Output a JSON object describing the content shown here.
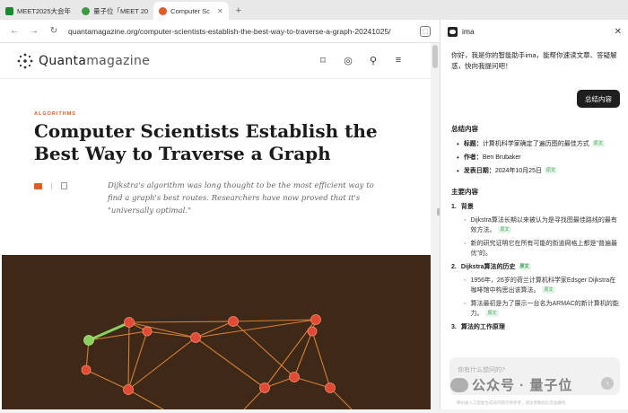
{
  "browser": {
    "tabs": [
      {
        "label": "MEET2025大会年",
        "active": false,
        "favicon_color": "#1a8a2e"
      },
      {
        "label": "量子位「MEET 20",
        "active": false,
        "favicon_color": "#3a9a40"
      },
      {
        "label": "Computer Sc",
        "active": true,
        "favicon_color": "#e35b24"
      }
    ],
    "new_tab": "+",
    "url": "quantamagazine.org/computer-scientists-establish-the-best-way-to-traverse-a-graph-20241025/"
  },
  "site": {
    "logo_bold": "Quanta",
    "logo_light": "magazine",
    "header_icons": [
      "bookmark-icon",
      "user-icon",
      "search-icon",
      "menu-icon"
    ]
  },
  "article": {
    "category": "ALGORITHMS",
    "title": "Computer Scientists Establish the Best Way to Traverse a Graph",
    "dek": "Dijkstra's algorithm was long thought to be the most efficient way to find a graph's best routes. Researchers have now proved that it's \"universally optimal.\""
  },
  "assistant": {
    "title": "ima",
    "greeting": "你好，我是你的智能助手ima，能帮你速读文章、答疑解惑，快向我提问吧！",
    "user_message": "总结内容",
    "summary_title": "总结内容",
    "source_tag": "原文",
    "meta": [
      {
        "key": "标题：",
        "value": "计算机科学家确定了遍历图的最佳方式"
      },
      {
        "key": "作者：",
        "value": "Ben Brubaker"
      },
      {
        "key": "发表日期：",
        "value": "2024年10月25日"
      }
    ],
    "main_title": "主要内容",
    "sections": [
      {
        "num": "1.",
        "title": "背景",
        "items": [
          "Dijkstra算法长期以来被认为是寻找图最佳路线的最有效方法。",
          "新的研究证明它在所有可能的街道网格上都是\"普遍最优\"的。"
        ]
      },
      {
        "num": "2.",
        "title": "Dijkstra算法的历史",
        "items": [
          "1956年，26岁的荷兰计算机科学家Edsger Dijkstra在咖啡馆中构思出该算法。",
          "算法最初是为了展示一台名为ARMAC的新计算机的能力。"
        ]
      },
      {
        "num": "3.",
        "title": "算法的工作原理",
        "items": []
      }
    ],
    "input_placeholder": "你有什么想问的?",
    "footnote": "腾讯由人工智能生成的内容仅供参考，请注意甄别信息准确性"
  },
  "watermark": "公众号 · 量子位",
  "colors": {
    "accent": "#e35b24",
    "hero_bg": "#3e2818",
    "node": "#e14b35",
    "edge": "#e8893a",
    "highlight": "#8ad05c"
  }
}
